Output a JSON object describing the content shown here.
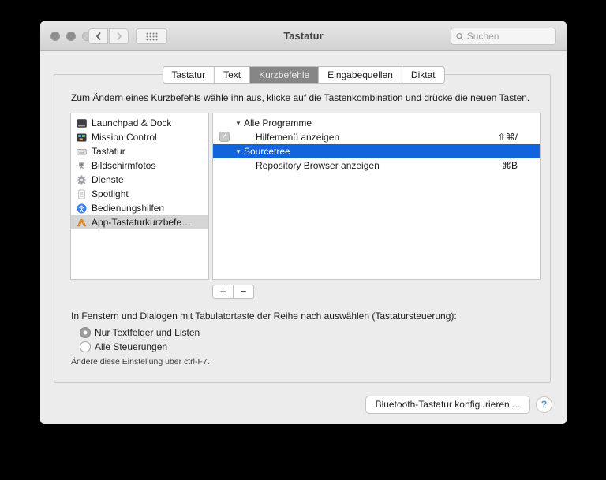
{
  "window": {
    "title": "Tastatur",
    "search": {
      "placeholder": "Suchen"
    }
  },
  "tabs": {
    "items": [
      {
        "label": "Tastatur",
        "selected": false
      },
      {
        "label": "Text",
        "selected": false
      },
      {
        "label": "Kurzbefehle",
        "selected": true
      },
      {
        "label": "Eingabequellen",
        "selected": false
      },
      {
        "label": "Diktat",
        "selected": false
      }
    ]
  },
  "instruction": "Zum Ändern eines Kurzbefehls wähle ihn aus, klicke auf die Tastenkombination und drücke die neuen Tasten.",
  "sidebar": {
    "items": [
      {
        "label": "Launchpad & Dock",
        "icon": "launchpad-dock-icon",
        "selected": false
      },
      {
        "label": "Mission Control",
        "icon": "mission-control-icon",
        "selected": false
      },
      {
        "label": "Tastatur",
        "icon": "keyboard-icon",
        "selected": false
      },
      {
        "label": "Bildschirmfotos",
        "icon": "screenshot-icon",
        "selected": false
      },
      {
        "label": "Dienste",
        "icon": "services-gear-icon",
        "selected": false
      },
      {
        "label": "Spotlight",
        "icon": "spotlight-icon",
        "selected": false
      },
      {
        "label": "Bedienungshilfen",
        "icon": "accessibility-icon",
        "selected": false
      },
      {
        "label": "App-Tastaturkurzbefe…",
        "icon": "app-shortcuts-icon",
        "selected": true
      }
    ]
  },
  "shortcuts": {
    "rows": [
      {
        "type": "group",
        "label": "Alle Programme",
        "disclosure": "▼",
        "selected": false
      },
      {
        "type": "item",
        "label": "Hilfemenü anzeigen",
        "checked": true,
        "check_glyph": "✓",
        "shortcut": "⇧⌘/"
      },
      {
        "type": "group",
        "label": "Sourcetree",
        "disclosure": "▼",
        "selected": true
      },
      {
        "type": "item",
        "label": "Repository Browser anzeigen",
        "checked": false,
        "shortcut": "⌘B"
      }
    ],
    "add_label": "+",
    "remove_label": "−"
  },
  "keyboard_nav": {
    "description": "In Fenstern und Dialogen mit Tabulatortaste der Reihe nach auswählen (Tastatursteuerung):",
    "options": [
      {
        "label": "Nur Textfelder und Listen",
        "selected": true
      },
      {
        "label": "Alle Steuerungen",
        "selected": false
      }
    ],
    "hint": "Ändere diese Einstellung über ctrl-F7."
  },
  "footer": {
    "bluetooth_button": "Bluetooth-Tastatur konfigurieren ...",
    "help_label": "?"
  },
  "colors": {
    "selection_blue": "#1164dc",
    "sidebar_selection": "#d5d5d5",
    "selected_tab_bg": "#868686",
    "window_bg": "#ececec",
    "titlebar_top": "#e8e8e8",
    "titlebar_bottom": "#d2d2d2"
  }
}
